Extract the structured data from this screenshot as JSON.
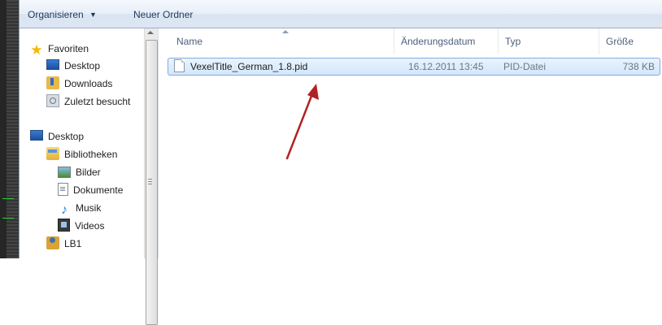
{
  "toolbar": {
    "organize_label": "Organisieren",
    "organize_arrow": "▼",
    "new_folder_label": "Neuer Ordner"
  },
  "navigation": {
    "favorites": {
      "label": "Favoriten",
      "items": [
        {
          "label": "Desktop",
          "icon": "desktop-icon"
        },
        {
          "label": "Downloads",
          "icon": "downloads-icon"
        },
        {
          "label": "Zuletzt besucht",
          "icon": "recent-places-icon"
        }
      ]
    },
    "desktop": {
      "label": "Desktop",
      "libraries": {
        "label": "Bibliotheken",
        "items": [
          {
            "label": "Bilder",
            "icon": "pictures-icon"
          },
          {
            "label": "Dokumente",
            "icon": "documents-icon"
          },
          {
            "label": "Musik",
            "icon": "music-icon"
          },
          {
            "label": "Videos",
            "icon": "videos-icon"
          }
        ]
      },
      "user": {
        "label": "LB1",
        "icon": "user-folder-icon"
      }
    }
  },
  "file_list": {
    "columns": {
      "name": "Name",
      "date": "Änderungsdatum",
      "type": "Typ",
      "size": "Größe"
    },
    "files": [
      {
        "name": "VexelTitle_German_1.8.pid",
        "date": "16.12.2011 13:45",
        "type": "PID-Datei",
        "size": "738 KB",
        "selected": true
      }
    ]
  },
  "annotation": {
    "color": "#b22222",
    "shape": "arrow pointing to selected file"
  }
}
